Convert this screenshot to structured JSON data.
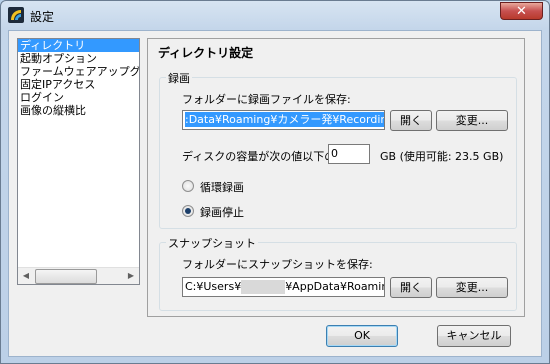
{
  "window": {
    "title": "設定",
    "close": "✕"
  },
  "sidebar": {
    "items": [
      {
        "label": "ディレクトリ",
        "selected": true
      },
      {
        "label": "起動オプション"
      },
      {
        "label": "ファームウェアアップグレード"
      },
      {
        "label": "固定IPアクセス"
      },
      {
        "label": "ログイン"
      },
      {
        "label": "画像の縦横比"
      }
    ]
  },
  "panel": {
    "title": "ディレクトリ設定",
    "recording": {
      "group_label": "録画",
      "save_label": "フォルダーに録画ファイルを保存:",
      "path_value": ":Data¥Roaming¥カメラー発¥Recording",
      "open_button": "開く",
      "change_button": "変更...",
      "disk_label": "ディスクの容量が次の値以下のとき",
      "disk_value": "0",
      "disk_unit": "GB (使用可能: 23.5 GB)",
      "radio_loop": "循環録画",
      "radio_stop": "録画停止"
    },
    "snapshot": {
      "group_label": "スナップショット",
      "save_label": "フォルダーにスナップショットを保存:",
      "path_prefix": "C:¥Users¥",
      "path_suffix": "¥AppData¥Roaming",
      "open_button": "開く",
      "change_button": "変更..."
    }
  },
  "footer": {
    "ok": "OK",
    "cancel": "キャンセル"
  }
}
